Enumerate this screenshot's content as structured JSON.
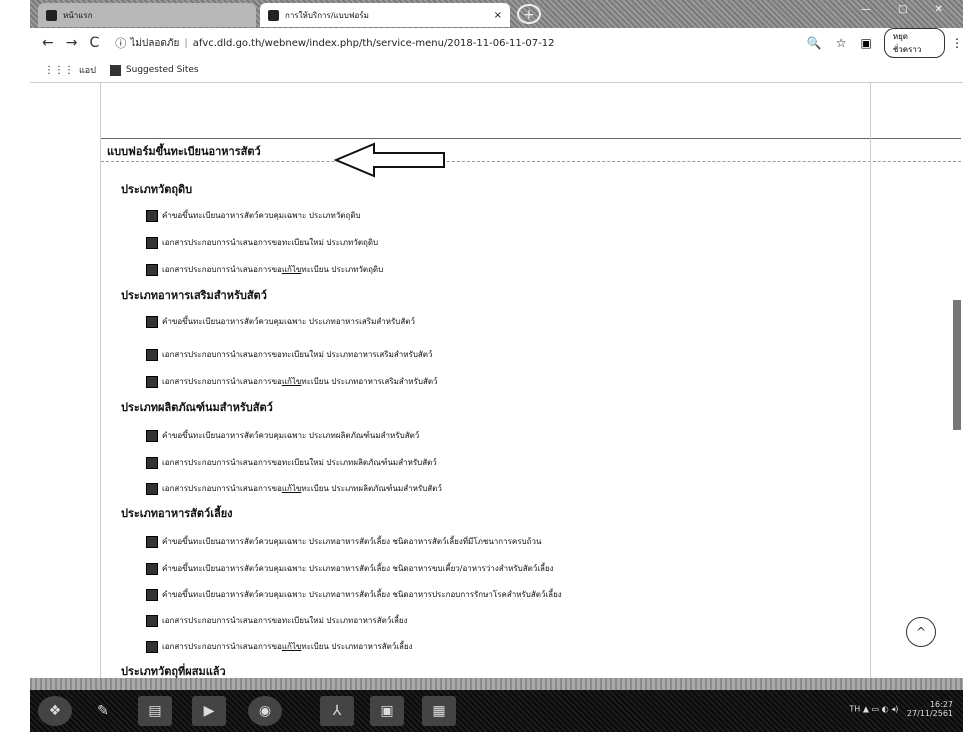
{
  "browser": {
    "tabs": [
      {
        "label": "หน้าแรก"
      },
      {
        "label": "การให้บริการ/แบบฟอร์ม"
      }
    ],
    "tab_close_glyph": "×",
    "new_tab_glyph": "+",
    "nav": {
      "back": "←",
      "forward": "→",
      "reload": "C"
    },
    "address": {
      "security_label": "ไม่ปลอดภัย",
      "url": "afvc.dld.go.th/webnew/index.php/th/service-menu/2018-11-06-11-07-12"
    },
    "profile_label": "หยุดชั่วคราว",
    "bookmarks": [
      {
        "label": "แอป"
      },
      {
        "label": "Suggested Sites"
      }
    ]
  },
  "page": {
    "title": "แบบฟอร์มขึ้นทะเบียนอาหารสัตว์",
    "sections": [
      {
        "heading": "ประเภทวัตถุดิบ",
        "items": [
          {
            "text": "คำขอขึ้นทะเบียนอาหารสัตว์ควบคุมเฉพาะ ประเภทวัตถุดิบ"
          },
          {
            "text": "เอกสารประกอบการนำเสนอการขอทะเบียนใหม่ ประเภทวัตถุดิบ"
          },
          {
            "pre": "เอกสารประกอบการนำเสนอการขอ",
            "ul": "แก้ไข",
            "post": "ทะเบียน ประเภทวัตถุดิบ"
          }
        ]
      },
      {
        "heading": "ประเภทอาหารเสริมสำหรับสัตว์",
        "items": [
          {
            "text": "คำขอขึ้นทะเบียนอาหารสัตว์ควบคุมเฉพาะ ประเภทอาหารเสริมสำหรับสัตว์"
          },
          {
            "text": "เอกสารประกอบการนำเสนอการขอทะเบียนใหม่ ประเภทอาหารเสริมสำหรับสัตว์"
          },
          {
            "pre": "เอกสารประกอบการนำเสนอการขอ",
            "ul": "แก้ไข",
            "post": "ทะเบียน ประเภทอาหารเสริมสำหรับสัตว์"
          }
        ]
      },
      {
        "heading": "ประเภทผลิตภัณฑ์นมสำหรับสัตว์",
        "items": [
          {
            "text": "คำขอขึ้นทะเบียนอาหารสัตว์ควบคุมเฉพาะ ประเภทผลิตภัณฑ์นมสำหรับสัตว์"
          },
          {
            "text": "เอกสารประกอบการนำเสนอการขอทะเบียนใหม่ ประเภทผลิตภัณฑ์นมสำหรับสัตว์"
          },
          {
            "pre": "เอกสารประกอบการนำเสนอการขอ",
            "ul": "แก้ไข",
            "post": "ทะเบียน ประเภทผลิตภัณฑ์นมสำหรับสัตว์"
          }
        ]
      },
      {
        "heading": "ประเภทอาหารสัตว์เลี้ยง",
        "items": [
          {
            "text": "คำขอขึ้นทะเบียนอาหารสัตว์ควบคุมเฉพาะ ประเภทอาหารสัตว์เลี้ยง ชนิดอาหารสัตว์เลี้ยงที่มีโภชนาการครบถ้วน"
          },
          {
            "text": "คำขอขึ้นทะเบียนอาหารสัตว์ควบคุมเฉพาะ ประเภทอาหารสัตว์เลี้ยง ชนิดอาหารขบเคี้ยว/อาหารว่างสำหรับสัตว์เลี้ยง"
          },
          {
            "text": "คำขอขึ้นทะเบียนอาหารสัตว์ควบคุมเฉพาะ ประเภทอาหารสัตว์เลี้ยง ชนิดอาหารประกอบการรักษาโรคสำหรับสัตว์เลี้ยง"
          },
          {
            "text": "เอกสารประกอบการนำเสนอการขอทะเบียนใหม่ ประเภทอาหารสัตว์เลี้ยง"
          },
          {
            "pre": "เอกสารประกอบการนำเสนอการขอ",
            "ul": "แก้ไข",
            "post": "ทะเบียน ประเภทอาหารสัตว์เลี้ยง"
          }
        ]
      },
      {
        "heading": "ประเภทวัตถุที่ผสมแล้ว",
        "items": []
      }
    ],
    "scroll_top_glyph": "^"
  },
  "taskbar": {
    "clock_time": "16:27",
    "clock_date": "27/11/2561",
    "tray_lang": "TH"
  }
}
